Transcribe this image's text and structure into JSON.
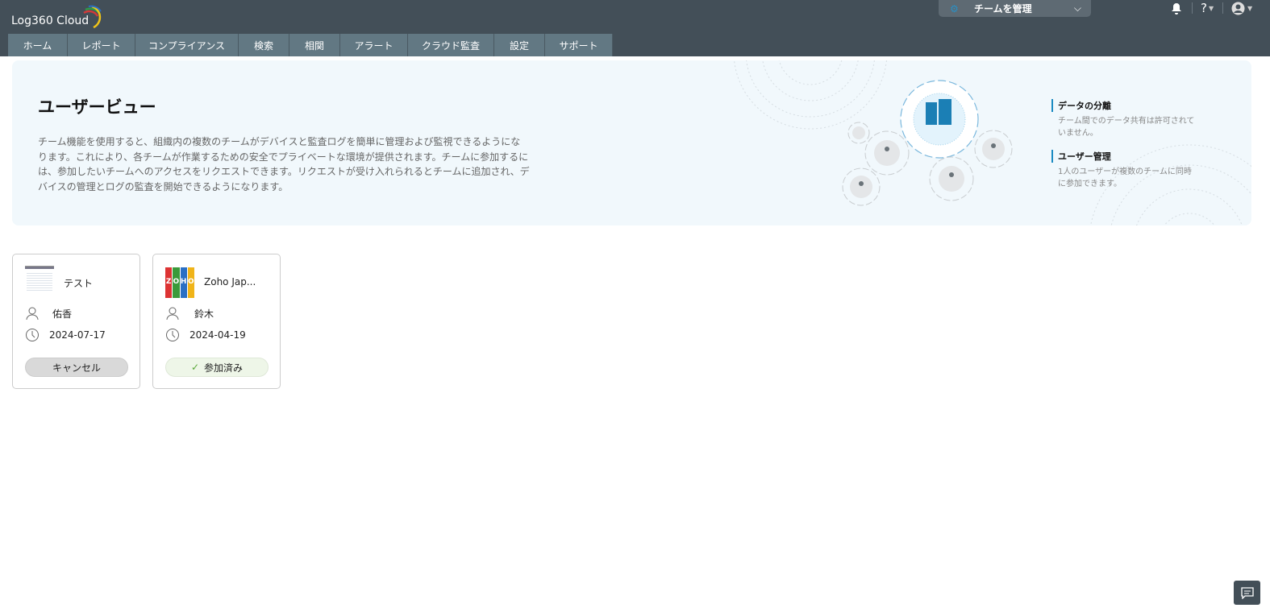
{
  "app": {
    "logo": "Log360 Cloud"
  },
  "nav": {
    "tabs": [
      {
        "label": "ホーム"
      },
      {
        "label": "レポート"
      },
      {
        "label": "コンプライアンス"
      },
      {
        "label": "検索"
      },
      {
        "label": "相関"
      },
      {
        "label": "アラート"
      },
      {
        "label": "クラウド監査"
      },
      {
        "label": "設定"
      },
      {
        "label": "サポート"
      }
    ]
  },
  "header": {
    "team_select": "チームを管理",
    "help": "?"
  },
  "banner": {
    "title": "ユーザービュー",
    "description": "チーム機能を使用すると、組織内の複数のチームがデバイスと監査ログを簡単に管理および監視できるようになります。これにより、各チームが作業するための安全でプライベートな環境が提供されます。チームに参加するには、参加したいチームへのアクセスをリクエストできます。リクエストが受け入れられるとチームに追加され、デバイスの管理とログの監査を開始できるようになります。",
    "features": [
      {
        "title": "データの分離",
        "text": "チーム間でのデータ共有は許可されていません。"
      },
      {
        "title": "ユーザー管理",
        "text": "1人のユーザーが複数のチームに同時に参加できます。"
      }
    ]
  },
  "teams": [
    {
      "name": "テスト",
      "user": "佑香",
      "date": "2024-07-17",
      "action": "キャンセル"
    },
    {
      "name": "Zoho Jap...",
      "logo": "ZOHO",
      "user": "鈴木",
      "date": "2024-04-19",
      "action": "参加済み"
    }
  ],
  "colors": {
    "header": "#434f58",
    "tab": "#627883",
    "accent": "#1b8bc2",
    "joined_bg": "#eef6e8",
    "cancel_bg": "#d9d9d9"
  }
}
